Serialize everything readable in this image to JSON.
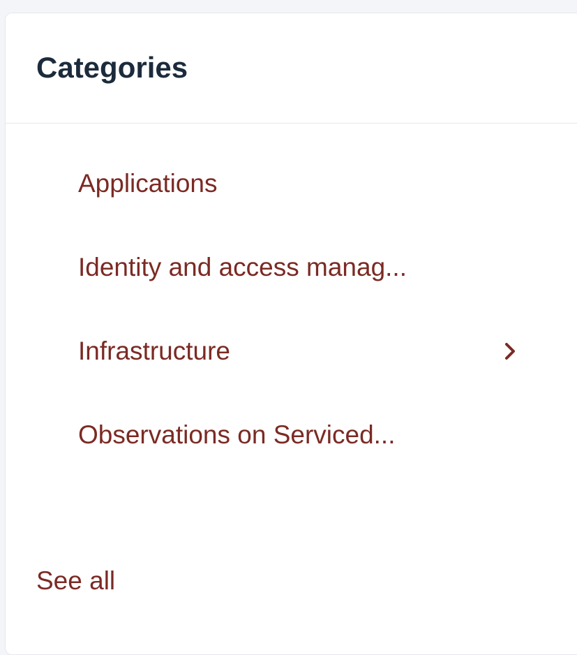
{
  "panel": {
    "title": "Categories",
    "items": [
      {
        "label": "Applications",
        "has_children": false
      },
      {
        "label": "Identity and access manag...",
        "has_children": false
      },
      {
        "label": "Infrastructure",
        "has_children": true
      },
      {
        "label": "Observations on Serviced...",
        "has_children": false
      }
    ],
    "see_all_label": "See all"
  },
  "icons": {
    "expand": "chevron-right-icon"
  },
  "colors": {
    "link": "#7b2a24",
    "title": "#1c2b3c",
    "panel_bg": "#ffffff",
    "page_bg": "#f3f5f9",
    "border": "#e6e8ec"
  }
}
